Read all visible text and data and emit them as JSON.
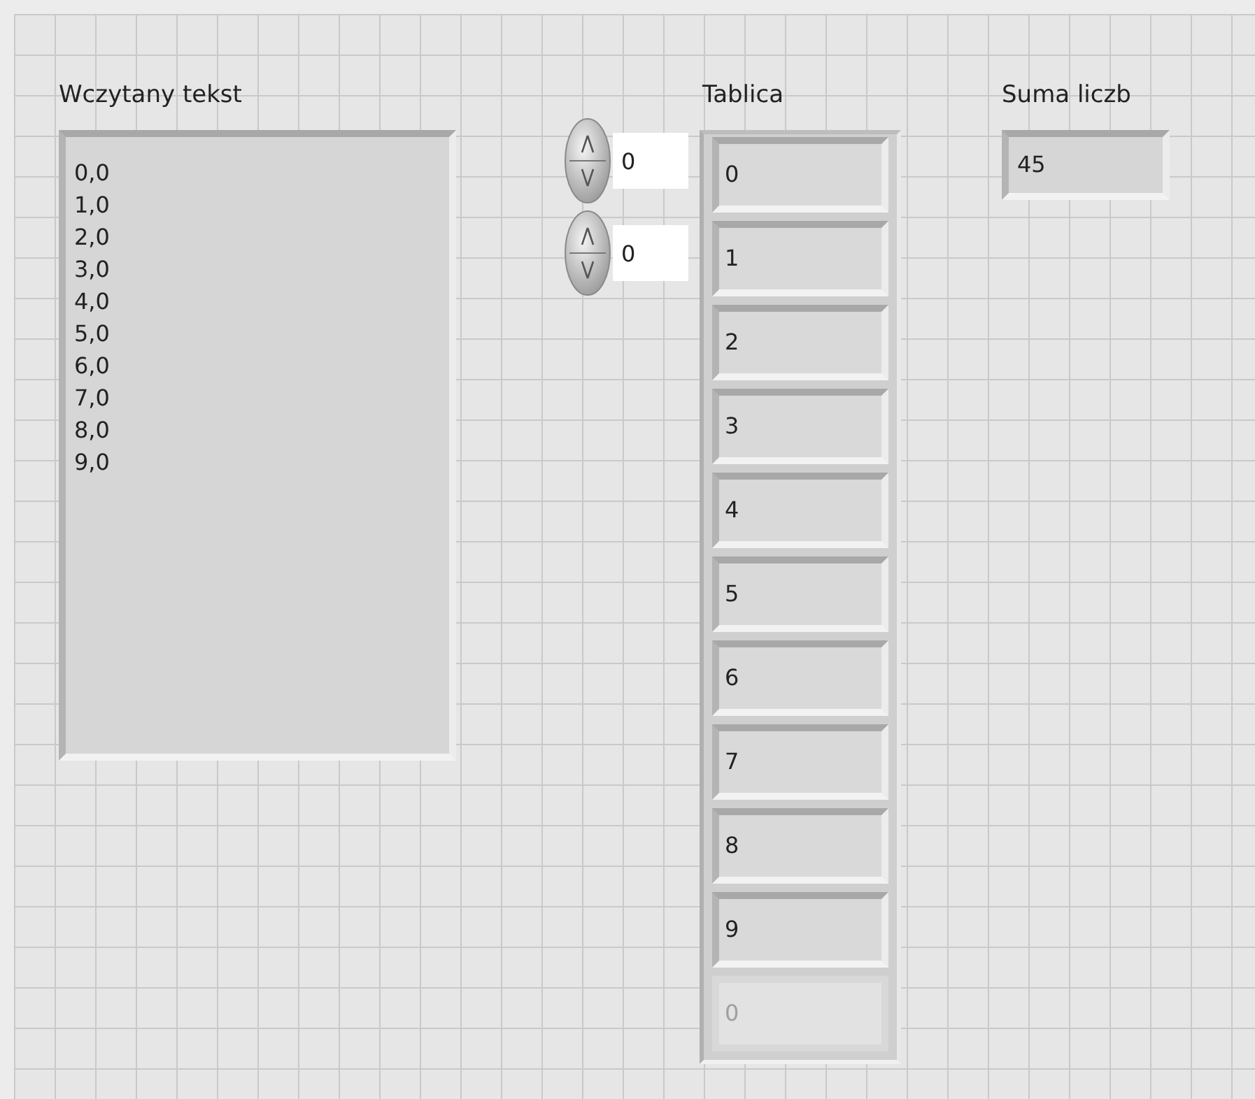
{
  "string_indicator": {
    "label": "Wczytany tekst",
    "lines": [
      "0,0",
      "1,0",
      "2,0",
      "3,0",
      "4,0",
      "5,0",
      "6,0",
      "7,0",
      "8,0",
      "9,0"
    ]
  },
  "array": {
    "label": "Tablica",
    "indices": [
      {
        "value": "0"
      },
      {
        "value": "0"
      }
    ],
    "elements": [
      {
        "value": "0",
        "disabled": false
      },
      {
        "value": "1",
        "disabled": false
      },
      {
        "value": "2",
        "disabled": false
      },
      {
        "value": "3",
        "disabled": false
      },
      {
        "value": "4",
        "disabled": false
      },
      {
        "value": "5",
        "disabled": false
      },
      {
        "value": "6",
        "disabled": false
      },
      {
        "value": "7",
        "disabled": false
      },
      {
        "value": "8",
        "disabled": false
      },
      {
        "value": "9",
        "disabled": false
      },
      {
        "value": "0",
        "disabled": true
      }
    ]
  },
  "sum_indicator": {
    "label": "Suma liczb",
    "value": "45"
  }
}
